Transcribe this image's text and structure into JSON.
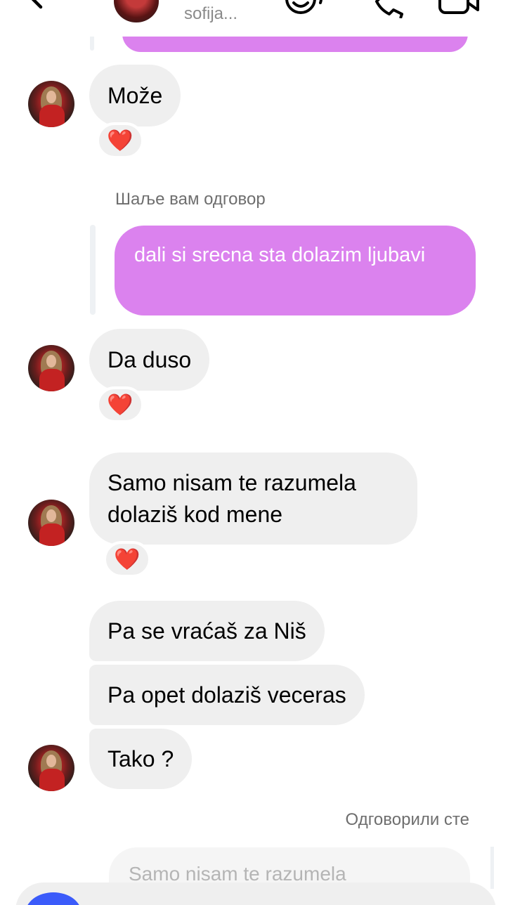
{
  "header": {
    "contact_name": "sofija...",
    "icons": [
      "back-arrow-icon",
      "sticker-icon",
      "phone-icon",
      "video-camera-icon"
    ]
  },
  "thread": {
    "messages": [
      {
        "sender": "them",
        "text": "Može",
        "reaction": "❤️"
      },
      {
        "sender": "me",
        "caption": "Шаље вам одговор",
        "text": "dali si srecna sta dolazim ljubavi"
      },
      {
        "sender": "them",
        "text": "Da duso",
        "reaction": "❤️"
      },
      {
        "sender": "them",
        "text": "Samo nisam te razumela dolaziš kod mene",
        "reaction": "❤️"
      },
      {
        "sender": "them",
        "text": "Pa se vraćaš za Niš"
      },
      {
        "sender": "them",
        "text": "Pa opet dolaziš veceras"
      },
      {
        "sender": "them",
        "text": "Tako ?"
      }
    ],
    "reply_status": "Одговорили сте",
    "quoted_preview": "Samo nisam te razumela"
  },
  "colors": {
    "outgoing_bubble": "#db82ee",
    "incoming_bubble": "#efefef",
    "reaction_heart": "#e8202a",
    "camera_button": "#3b5bfa"
  }
}
